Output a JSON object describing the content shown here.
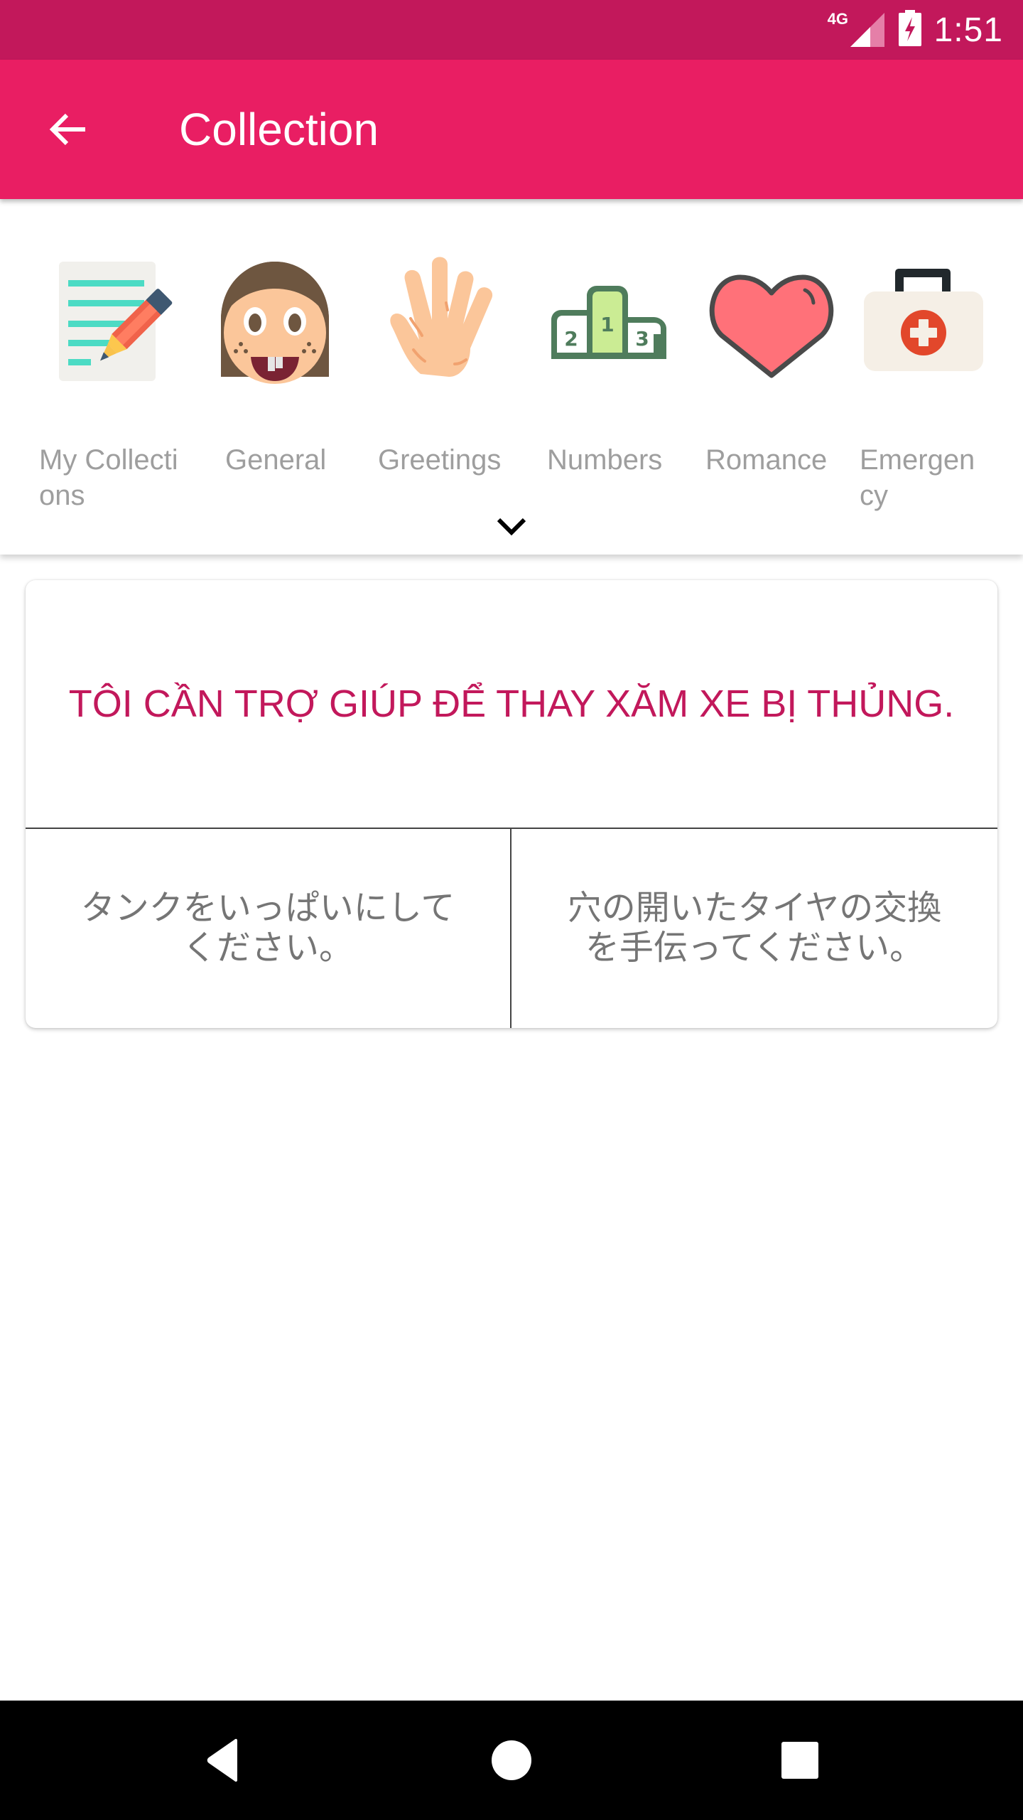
{
  "status_bar": {
    "network": "4G",
    "time": "1:51",
    "signal_icon": "signal-icon",
    "battery_icon": "battery-charging-icon"
  },
  "app_bar": {
    "title": "Collection",
    "back_icon": "arrow-back-icon"
  },
  "categories": [
    {
      "label": "My Collections",
      "icon": "notepad-pencil-icon"
    },
    {
      "label": "General",
      "icon": "smiling-face-icon"
    },
    {
      "label": "Greetings",
      "icon": "waving-hand-icon"
    },
    {
      "label": "Numbers",
      "icon": "podium-icon"
    },
    {
      "label": "Romance",
      "icon": "heart-icon"
    },
    {
      "label": "Emergency",
      "icon": "first-aid-kit-icon"
    }
  ],
  "expand_icon": "chevron-down-icon",
  "quiz": {
    "question": "TÔI CẦN TRỢ GIÚP ĐỂ THAY XĂM XE BỊ THỦNG.",
    "answers": [
      "タンクをいっぱいにしてください。",
      "穴の開いたタイヤの交換を手伝ってください。"
    ]
  },
  "colors": {
    "status_bar": "#c2185b",
    "app_bar": "#e91e63",
    "question_text": "#c2185b",
    "answer_text": "#757575",
    "category_label": "#9e9e9e"
  },
  "nav_bar": {
    "back": "nav-back-icon",
    "home": "nav-home-icon",
    "recents": "nav-recents-icon"
  }
}
